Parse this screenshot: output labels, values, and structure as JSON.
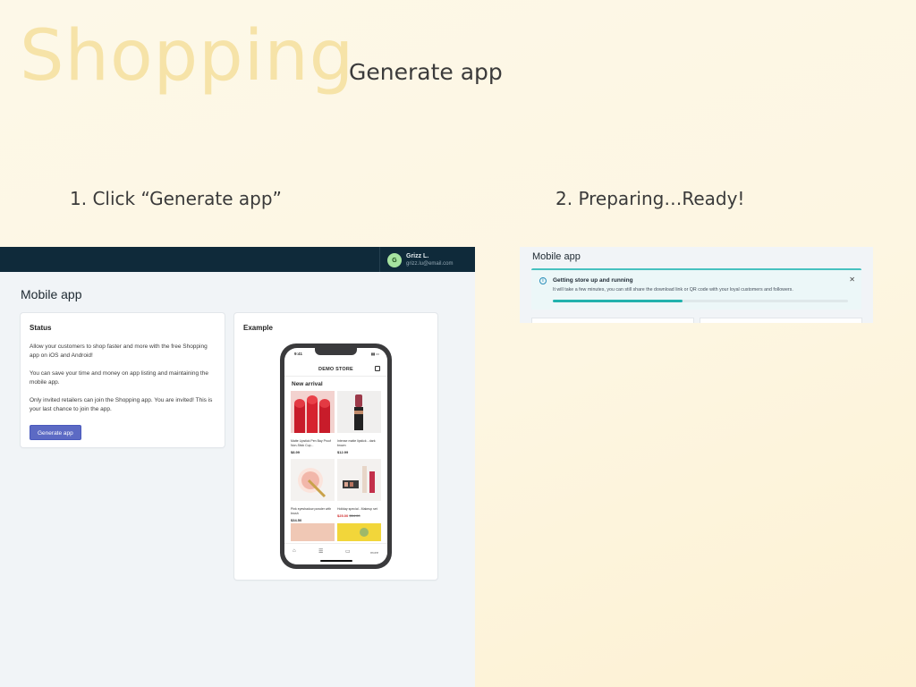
{
  "header": {
    "title": "Shopping",
    "subtitle": "Generate app"
  },
  "steps": [
    {
      "label": "1. Click “Generate app”"
    },
    {
      "label": "2. Preparing…Ready!"
    }
  ],
  "admin": {
    "user": {
      "initial": "G",
      "name": "Grizz L.",
      "email": "grizz.lu@email.com"
    },
    "page_title": "Mobile app",
    "status_card": {
      "title": "Status",
      "paragraphs": [
        "Allow your customers to shop faster and more with the free Shopping app on iOS and Android!",
        "You can save your time and money on app listing and maintaining the mobile app.",
        "Only invited retailers can join the Shopping app. You are invited! This is your last chance to join the app."
      ],
      "button_label": "Generate app"
    },
    "example_card": {
      "title": "Example",
      "phone": {
        "time": "9:41",
        "store_name": "DEMO STORE",
        "section_title": "New arrival",
        "products": [
          {
            "name": "Matte Lipstick Pen Bay Proof Non-Stick Cup...",
            "price": "$8.99",
            "old_price": ""
          },
          {
            "name": "Intense matte lipstick - dark brown",
            "price": "$12.99",
            "old_price": ""
          },
          {
            "name": "Pink eyeshadow powder with brush",
            "price": "$34.50",
            "old_price": ""
          },
          {
            "name": "Holiday special - Makeup set",
            "price": "$25.00",
            "old_price": "$54.00"
          }
        ],
        "tab_more": "more"
      }
    }
  },
  "preparing": {
    "page_title": "Mobile app",
    "banner": {
      "title": "Getting store up and running",
      "text": "It will take a few minutes, you can still share the download link or QR code with your loyal customers and followers.",
      "progress": 0.44
    }
  },
  "colors": {
    "title_accent": "#f6e3a8",
    "topbar": "#0f2a3a",
    "primary_button": "#5c6ac4",
    "banner_accent": "#47c1bf",
    "progress": "#1fb2ad"
  }
}
